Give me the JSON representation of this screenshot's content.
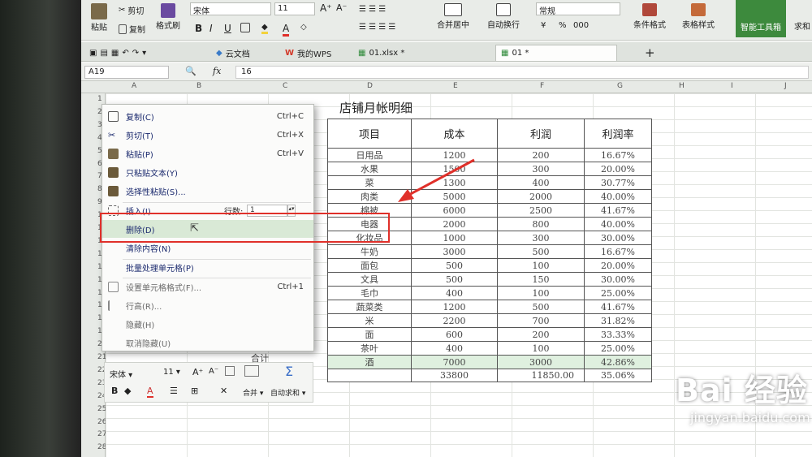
{
  "ribbon": {
    "paste": "粘贴",
    "cut": "剪切",
    "copy": "复制",
    "format_painter": "格式刷",
    "font_name": "宋体",
    "font_size": "11",
    "font_grow": "A⁺",
    "font_shrink": "A⁻",
    "bold": "B",
    "italic": "I",
    "underline": "U",
    "merge_center": "合并居中",
    "wrap_text": "自动换行",
    "number_format": "常规",
    "percent": "%",
    "thousands": "000",
    "cond_format": "条件格式",
    "table_style": "表格样式",
    "smart_toolbox": "智能工具箱",
    "sum_partial": "求和"
  },
  "tabs": {
    "cloud_docs": "云文档",
    "my_wps": "我的WPS",
    "file1": "01.xlsx *",
    "file2": "01 *",
    "add": "+"
  },
  "formula_bar": {
    "cell_ref": "A19",
    "fx": "fx",
    "value": "16"
  },
  "columns": [
    "A",
    "B",
    "C",
    "D",
    "E",
    "F",
    "G",
    "H",
    "I",
    "J"
  ],
  "rows": [
    "1",
    "2",
    "3",
    "4",
    "5",
    "6",
    "7",
    "8",
    "9",
    "10",
    "11",
    "12",
    "13",
    "14",
    "15",
    "16",
    "17",
    "18",
    "19",
    "20",
    "21",
    "22",
    "23",
    "24",
    "25",
    "26",
    "27",
    "28"
  ],
  "sheet": {
    "title": "店铺月帐明细",
    "headers": [
      "项目",
      "成本",
      "利润",
      "利润率"
    ],
    "data": [
      [
        "日用品",
        "1200",
        "200",
        "16.67%"
      ],
      [
        "水果",
        "1500",
        "300",
        "20.00%"
      ],
      [
        "菜",
        "1300",
        "400",
        "30.77%"
      ],
      [
        "肉类",
        "5000",
        "2000",
        "40.00%"
      ],
      [
        "棉被",
        "6000",
        "2500",
        "41.67%"
      ],
      [
        "电器",
        "2000",
        "800",
        "40.00%"
      ],
      [
        "化妆品",
        "1000",
        "300",
        "30.00%"
      ],
      [
        "牛奶",
        "3000",
        "500",
        "16.67%"
      ],
      [
        "面包",
        "500",
        "100",
        "20.00%"
      ],
      [
        "文具",
        "500",
        "150",
        "30.00%"
      ],
      [
        "毛巾",
        "400",
        "100",
        "25.00%"
      ],
      [
        "蔬菜类",
        "1200",
        "500",
        "41.67%"
      ],
      [
        "米",
        "2200",
        "700",
        "31.82%"
      ],
      [
        "面",
        "600",
        "200",
        "33.33%"
      ],
      [
        "茶叶",
        "400",
        "100",
        "25.00%"
      ],
      [
        "酒",
        "7000",
        "3000",
        "42.86%"
      ]
    ],
    "total_label": "合计",
    "totals": [
      "33800",
      "11850.00",
      "35.06%"
    ]
  },
  "context_menu": {
    "copy": "复制(C)",
    "copy_sc": "Ctrl+C",
    "cut": "剪切(T)",
    "cut_sc": "Ctrl+X",
    "paste": "粘贴(P)",
    "paste_sc": "Ctrl+V",
    "paste_text": "只粘贴文本(Y)",
    "paste_special": "选择性粘贴(S)...",
    "insert": "插入(I)",
    "rows_label": "行数:",
    "rows_value": "1",
    "delete": "删除(D)",
    "clear": "清除内容(N)",
    "batch": "批量处理单元格(P)",
    "format_cells": "设置单元格格式(F)...",
    "format_sc": "Ctrl+1",
    "row_height": "行高(R)...",
    "hide": "隐藏(H)",
    "unhide": "取消隐藏(U)"
  },
  "mini_toolbar": {
    "font": "宋体",
    "size": "11",
    "grow": "A⁺",
    "shrink": "A⁻",
    "bold": "B",
    "merge": "合并",
    "autosum": "自动求和"
  },
  "watermark": {
    "brand": "Bai  经验",
    "url": "jingyan.baidu.com"
  },
  "colors": {
    "selection_green": "#dff0df",
    "highlight_red": "#e0302a",
    "smart_button": "#3d8a3d"
  }
}
